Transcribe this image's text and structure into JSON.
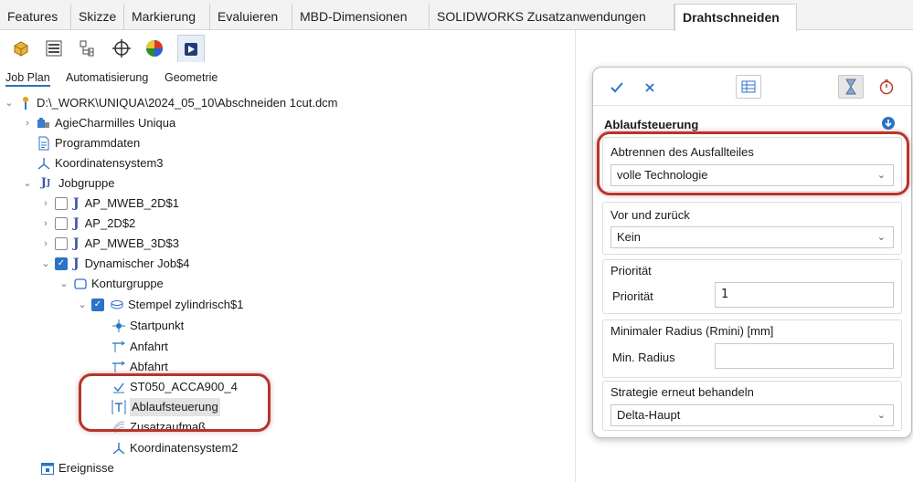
{
  "ribbon": {
    "tabs": [
      "Features",
      "Skizze",
      "Markierung",
      "Evaluieren",
      "MBD-Dimensionen",
      "SOLIDWORKS Zusatzanwendungen",
      "Drahtschneiden"
    ],
    "active_tab": "Drahtschneiden"
  },
  "left_panel": {
    "subtabs": [
      "Job Plan",
      "Automatisierung",
      "Geometrie"
    ],
    "active_subtab": "Job Plan",
    "tree": {
      "root": "D:\\_WORK\\UNIQUA\\2024_05_10\\Abschneiden 1cut.dcm",
      "machine": "AgieCharmilles Uniqua",
      "program_data": "Programmdaten",
      "coord_system": "Koordinatensystem3",
      "job_group": "Jobgruppe",
      "jobs": [
        {
          "label": "AP_MWEB_2D$1",
          "checked": false
        },
        {
          "label": "AP_2D$2",
          "checked": false
        },
        {
          "label": "AP_MWEB_3D$3",
          "checked": false
        },
        {
          "label": "Dynamischer Job$4",
          "checked": true
        }
      ],
      "contour_group": "Konturgruppe",
      "contour": "Stempel zylindrisch$1",
      "contour_children": [
        "Startpunkt",
        "Anfahrt",
        "Abfahrt",
        "ST050_ACCA900_4",
        "Ablaufsteuerung",
        "Zusatzaufmaß",
        "Koordinatensystem2"
      ],
      "events": "Ereignisse"
    }
  },
  "property_panel": {
    "title": "Ablaufsteuerung",
    "groups": {
      "separation": {
        "label": "Abtrennen des Ausfallteiles",
        "value": "volle Technologie"
      },
      "forward_back": {
        "label": "Vor und zurück",
        "value": "Kein"
      },
      "priority": {
        "label": "Priorität",
        "field_label": "Priorität",
        "value": "1"
      },
      "min_radius": {
        "label": "Minimaler Radius (Rmini) [mm]",
        "field_label": "Min. Radius",
        "value": ""
      },
      "strategy": {
        "label": "Strategie erneut behandeln",
        "value": "Delta-Haupt"
      }
    }
  },
  "colors": {
    "accent": "#2b73c7",
    "callout": "#b5362a"
  }
}
